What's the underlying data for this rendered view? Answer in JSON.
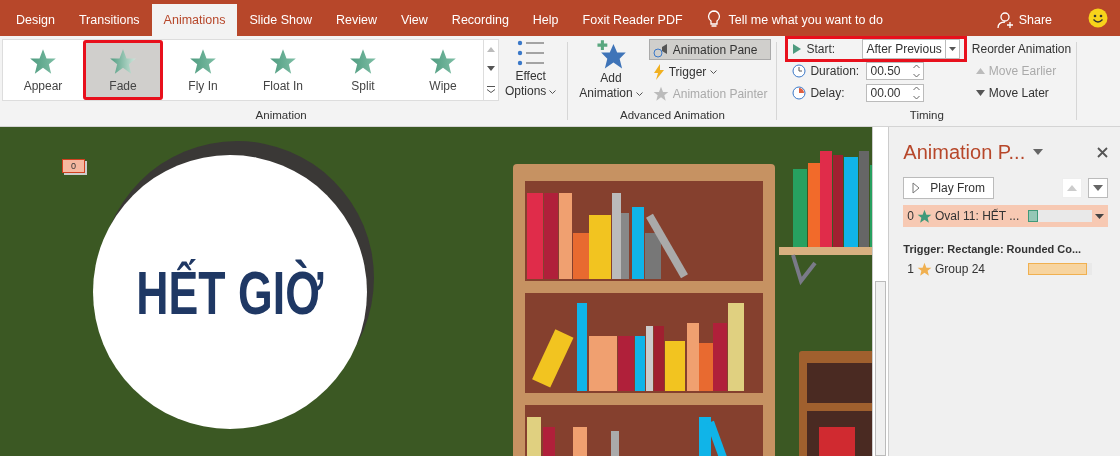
{
  "tabs": [
    {
      "label": "Design",
      "selected": false
    },
    {
      "label": "Transitions",
      "selected": false
    },
    {
      "label": "Animations",
      "selected": true
    },
    {
      "label": "Slide Show",
      "selected": false
    },
    {
      "label": "Review",
      "selected": false
    },
    {
      "label": "View",
      "selected": false
    },
    {
      "label": "Recording",
      "selected": false
    },
    {
      "label": "Help",
      "selected": false
    },
    {
      "label": "Foxit Reader PDF",
      "selected": false
    }
  ],
  "tell_me": "Tell me what you want to do",
  "share": "Share",
  "animation_group": {
    "label": "Animation",
    "effects": [
      {
        "label": "Appear",
        "selected": false,
        "highlighted": false
      },
      {
        "label": "Fade",
        "selected": true,
        "highlighted": true
      },
      {
        "label": "Fly In",
        "selected": false,
        "highlighted": false
      },
      {
        "label": "Float In",
        "selected": false,
        "highlighted": false
      },
      {
        "label": "Split",
        "selected": false,
        "highlighted": false
      },
      {
        "label": "Wipe",
        "selected": false,
        "highlighted": false
      }
    ],
    "effect_options": [
      "Effect",
      "Options"
    ]
  },
  "advanced_group": {
    "label": "Advanced Animation",
    "add_animation": [
      "Add",
      "Animation"
    ],
    "animation_pane": {
      "label": "Animation Pane",
      "selected": true
    },
    "trigger": {
      "label": "Trigger",
      "disabled": false
    },
    "animation_painter": {
      "label": "Animation Painter",
      "disabled": true
    }
  },
  "timing_group": {
    "label": "Timing",
    "start": {
      "label": "Start:",
      "value": "After Previous",
      "highlighted": true
    },
    "duration": {
      "label": "Duration:",
      "value": "00.50"
    },
    "delay": {
      "label": "Delay:",
      "value": "00.00"
    },
    "reorder": "Reorder Animation",
    "move_earlier": {
      "label": "Move Earlier",
      "disabled": true
    },
    "move_later": {
      "label": "Move Later",
      "disabled": false
    }
  },
  "slide": {
    "badge": "0",
    "title": "HẾT GIỜ"
  },
  "animation_pane": {
    "title": "Animation P...",
    "play_from": "Play From",
    "items": [
      {
        "kind": "item",
        "number": "0",
        "label": "Oval 11: HẾT ...",
        "selected": true,
        "color": "#3f9a7a",
        "level": 0.15
      },
      {
        "kind": "trigger",
        "label": "Trigger: Rectangle: Rounded Co..."
      },
      {
        "kind": "item",
        "number": "1",
        "label": "Group 24",
        "selected": false,
        "color": "#f0b050",
        "level": 0.92
      }
    ]
  }
}
